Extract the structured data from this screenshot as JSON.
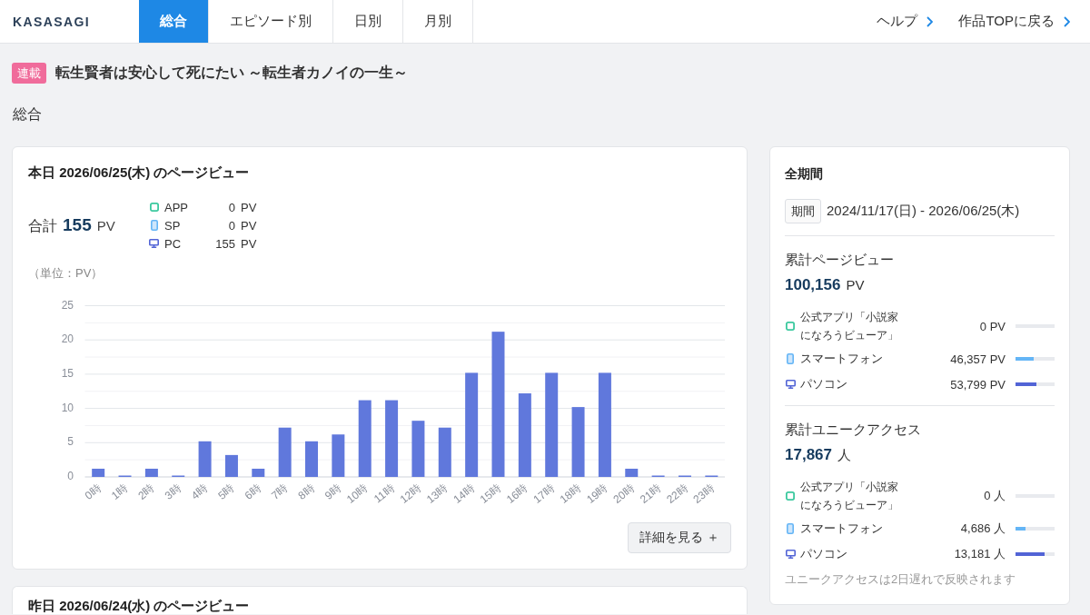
{
  "nav": {
    "logo": "KASASAGI",
    "tabs": [
      {
        "label": "総合",
        "selected": true
      },
      {
        "label": "エピソード別",
        "selected": false
      },
      {
        "label": "日別",
        "selected": false
      },
      {
        "label": "月別",
        "selected": false
      }
    ],
    "links": [
      "ヘルプ",
      "作品TOPに戻る"
    ]
  },
  "work": {
    "badge": "連載",
    "title": "転生賢者は安心して死にたい ～転生者カノイの一生～"
  },
  "section_heading": "総合",
  "today": {
    "title": "本日 2026/06/25(木) のページビュー",
    "total": {
      "label": "合計",
      "value": "155",
      "unit": "PV"
    },
    "breakdown": [
      {
        "kind": "app",
        "label": "APP",
        "value": "0",
        "unit": "PV"
      },
      {
        "kind": "phone",
        "label": "SP",
        "value": "0",
        "unit": "PV"
      },
      {
        "kind": "pc",
        "label": "PC",
        "value": "155",
        "unit": "PV"
      }
    ],
    "chart_data": {
      "type": "bar",
      "ylabel": "（単位：PV）",
      "categories": [
        "0時",
        "1時",
        "2時",
        "3時",
        "4時",
        "5時",
        "6時",
        "7時",
        "8時",
        "9時",
        "10時",
        "11時",
        "12時",
        "13時",
        "14時",
        "15時",
        "16時",
        "17時",
        "18時",
        "19時",
        "20時",
        "21時",
        "22時",
        "23時"
      ],
      "values": [
        1,
        0,
        1,
        0,
        5,
        3,
        1,
        7,
        5,
        6,
        11,
        11,
        8,
        7,
        15,
        21,
        12,
        15,
        10,
        15,
        1,
        0,
        0,
        0
      ],
      "color": "#6078dc",
      "ylim": [
        0,
        25
      ],
      "yticks": [
        0,
        5,
        10,
        15,
        20,
        25
      ],
      "grid": true
    },
    "detail_button": "詳細を見る ＋"
  },
  "all_time": {
    "title": "全期間",
    "period_label": "期間",
    "period": "2024/11/17(日) - 2026/06/25(木)",
    "sections": [
      {
        "heading": "累計ページビュー",
        "total": "100,156",
        "unit": "PV",
        "rows": [
          {
            "kind": "app",
            "label": "公式アプリ「小説家になろうビューア」",
            "value": "0 PV",
            "level": 0
          },
          {
            "kind": "phone",
            "label": "スマートフォン",
            "value": "46,357 PV",
            "level": 0.46
          },
          {
            "kind": "pc",
            "label": "パソコン",
            "value": "53,799 PV",
            "level": 0.54
          }
        ]
      },
      {
        "heading": "累計ユニークアクセス",
        "total": "17,867",
        "unit": "人",
        "rows": [
          {
            "kind": "app",
            "label": "公式アプリ「小説家になろうビューア」",
            "value": "0 人",
            "level": 0
          },
          {
            "kind": "phone",
            "label": "スマートフォン",
            "value": "4,686 人",
            "level": 0.26
          },
          {
            "kind": "pc",
            "label": "パソコン",
            "value": "13,181 人",
            "level": 0.74
          }
        ]
      }
    ],
    "note": "ユニークアクセスは2日遅れで反映されます"
  },
  "yesterday": {
    "title": "昨日 2026/06/24(水) のページビュー"
  }
}
